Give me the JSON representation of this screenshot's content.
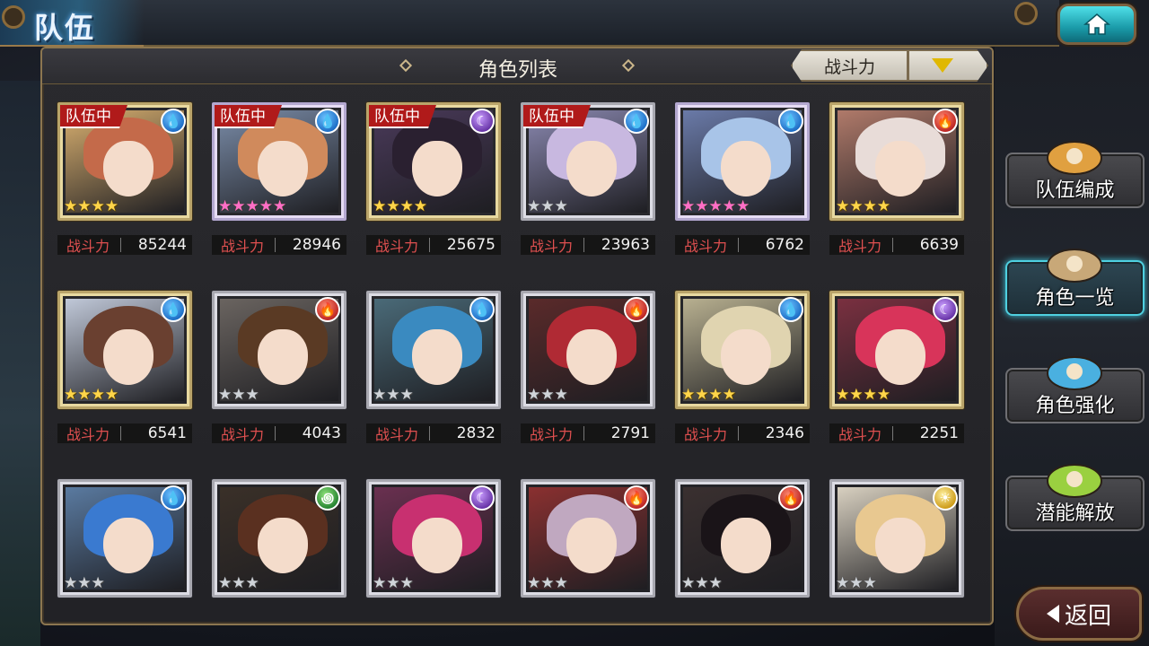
{
  "header": {
    "title": "队伍"
  },
  "panel": {
    "title": "角色列表"
  },
  "sort": {
    "label": "战斗力"
  },
  "power_label": "战斗力",
  "characters": [
    {
      "party": "队伍中",
      "element": "water",
      "frame": "gold",
      "stars": 4,
      "power": "85244",
      "hair": "#c46a4a",
      "bg": "#d9b070"
    },
    {
      "party": "队伍中",
      "element": "water",
      "frame": "rainbow",
      "stars": 5,
      "power": "28946",
      "hair": "#d08a5c",
      "bg": "#7a8ca8"
    },
    {
      "party": "队伍中",
      "element": "dark",
      "frame": "gold",
      "stars": 4,
      "power": "25675",
      "hair": "#2a2030",
      "bg": "#4a3a5a"
    },
    {
      "party": "队伍中",
      "element": "water",
      "frame": "silver",
      "stars": 3,
      "power": "23963",
      "hair": "#c8b8e0",
      "bg": "#8a88b0"
    },
    {
      "party": "",
      "element": "water",
      "frame": "rainbow",
      "stars": 5,
      "power": "6762",
      "hair": "#a8c4e8",
      "bg": "#6a7aa8"
    },
    {
      "party": "",
      "element": "fire",
      "frame": "gold",
      "stars": 4,
      "power": "6639",
      "hair": "#e8dcd8",
      "bg": "#b07a6a"
    },
    {
      "party": "",
      "element": "water",
      "frame": "gold",
      "stars": 4,
      "power": "6541",
      "hair": "#6a4030",
      "bg": "#c0c8d8"
    },
    {
      "party": "",
      "element": "fire",
      "frame": "silver",
      "stars": 3,
      "power": "4043",
      "hair": "#5a3a24",
      "bg": "#6a6460"
    },
    {
      "party": "",
      "element": "water",
      "frame": "silver",
      "stars": 3,
      "power": "2832",
      "hair": "#3a8ac0",
      "bg": "#4a6a78"
    },
    {
      "party": "",
      "element": "fire",
      "frame": "silver",
      "stars": 3,
      "power": "2791",
      "hair": "#b02a34",
      "bg": "#5a2a2a"
    },
    {
      "party": "",
      "element": "water",
      "frame": "gold",
      "stars": 4,
      "power": "2346",
      "hair": "#e0d4b0",
      "bg": "#b8b090"
    },
    {
      "party": "",
      "element": "dark",
      "frame": "gold",
      "stars": 4,
      "power": "2251",
      "hair": "#d8345a",
      "bg": "#7a3040"
    },
    {
      "party": "",
      "element": "water",
      "frame": "silver",
      "stars": 3,
      "power": "",
      "hair": "#3a7ad0",
      "bg": "#5a7aa0"
    },
    {
      "party": "",
      "element": "wind",
      "frame": "silver",
      "stars": 3,
      "power": "",
      "hair": "#5a3020",
      "bg": "#3a3028"
    },
    {
      "party": "",
      "element": "dark",
      "frame": "silver",
      "stars": 3,
      "power": "",
      "hair": "#c83070",
      "bg": "#6a3050"
    },
    {
      "party": "",
      "element": "fire",
      "frame": "silver",
      "stars": 3,
      "power": "",
      "hair": "#c0a8c0",
      "bg": "#8a3030"
    },
    {
      "party": "",
      "element": "fire",
      "frame": "silver",
      "stars": 3,
      "power": "",
      "hair": "#1a1418",
      "bg": "#3a3030"
    },
    {
      "party": "",
      "element": "light",
      "frame": "silver",
      "stars": 3,
      "power": "",
      "hair": "#e8c890",
      "bg": "#d8d0c0"
    }
  ],
  "side_menu": [
    {
      "label": "队伍编成",
      "icon": "party-members-icon",
      "active": false
    },
    {
      "label": "角色一览",
      "icon": "character-book-icon",
      "active": true
    },
    {
      "label": "角色强化",
      "icon": "enhance-crystal-icon",
      "active": false
    },
    {
      "label": "潜能解放",
      "icon": "potential-orb-icon",
      "active": false
    }
  ],
  "back": {
    "label": "返回"
  },
  "colors": {
    "accent_cyan": "#4fd0e0",
    "party_badge": "#b01a1a",
    "power_label": "#e05050",
    "star_gold": "#ffd54a"
  }
}
